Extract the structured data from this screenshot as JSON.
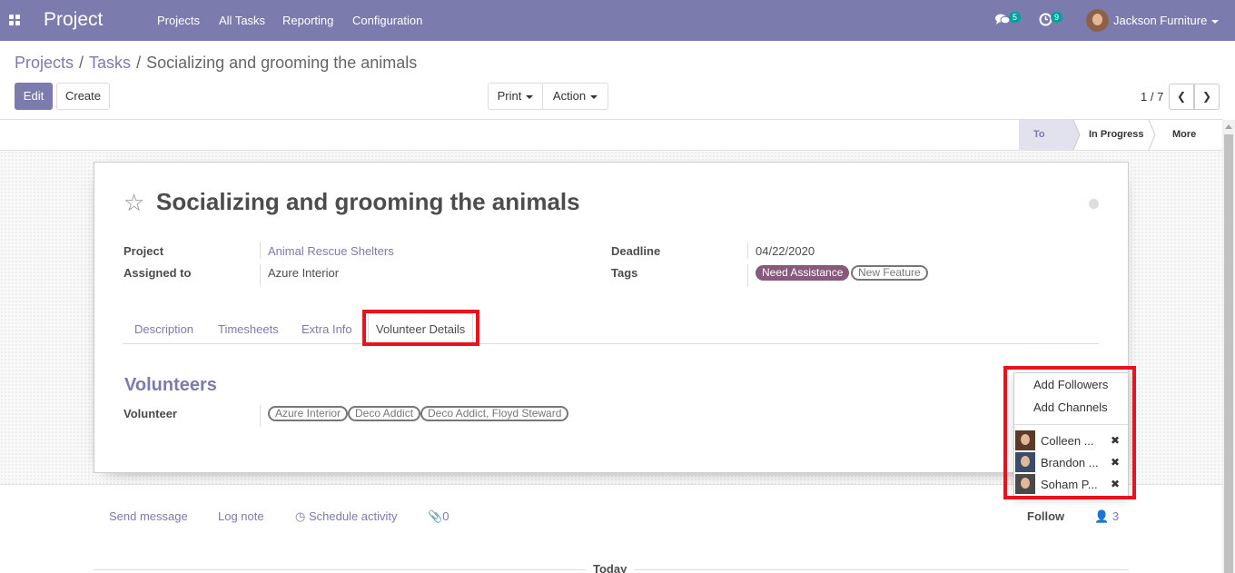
{
  "colors": {
    "brand": "#7c7bad",
    "highlight": "#e8141d",
    "tag_filled": "#875a7b"
  },
  "topbar": {
    "app_name": "Project",
    "menu": [
      "Projects",
      "All Tasks",
      "Reporting",
      "Configuration"
    ],
    "messages_count": "5",
    "activities_count": "9",
    "user_name": "Jackson Furniture"
  },
  "breadcrumb": {
    "root": "Projects",
    "middle": "Tasks",
    "current": "Socializing and grooming the animals"
  },
  "control_panel": {
    "edit_label": "Edit",
    "create_label": "Create",
    "print_label": "Print",
    "action_label": "Action",
    "pager": "1 / 7"
  },
  "statusbar": {
    "stage_todo": "To Do",
    "stage_in_progress": "In Progress",
    "more_label": "More"
  },
  "task": {
    "title": "Socializing and grooming the animals",
    "project_label": "Project",
    "project_value": "Animal Rescue Shelters",
    "assigned_label": "Assigned to",
    "assigned_value": "Azure Interior",
    "deadline_label": "Deadline",
    "deadline_value": "04/22/2020",
    "tags_label": "Tags",
    "tags": [
      "Need Assistance",
      "New Feature"
    ]
  },
  "tabs": [
    "Description",
    "Timesheets",
    "Extra Info",
    "Volunteer Details"
  ],
  "volunteers": {
    "section_title": "Volunteers",
    "field_label": "Volunteer",
    "values": [
      "Azure Interior",
      "Deco Addict",
      "Deco Addict, Floyd Steward"
    ]
  },
  "followers_dropdown": {
    "add_followers": "Add Followers",
    "add_channels": "Add Channels",
    "followers": [
      "Colleen ...",
      "Brandon ...",
      "Soham P..."
    ]
  },
  "chatter": {
    "send_message": "Send message",
    "log_note": "Log note",
    "schedule_activity": "Schedule activity",
    "attachments_count": "0",
    "follow_label": "Follow",
    "followers_count": "3",
    "today_label": "Today"
  }
}
